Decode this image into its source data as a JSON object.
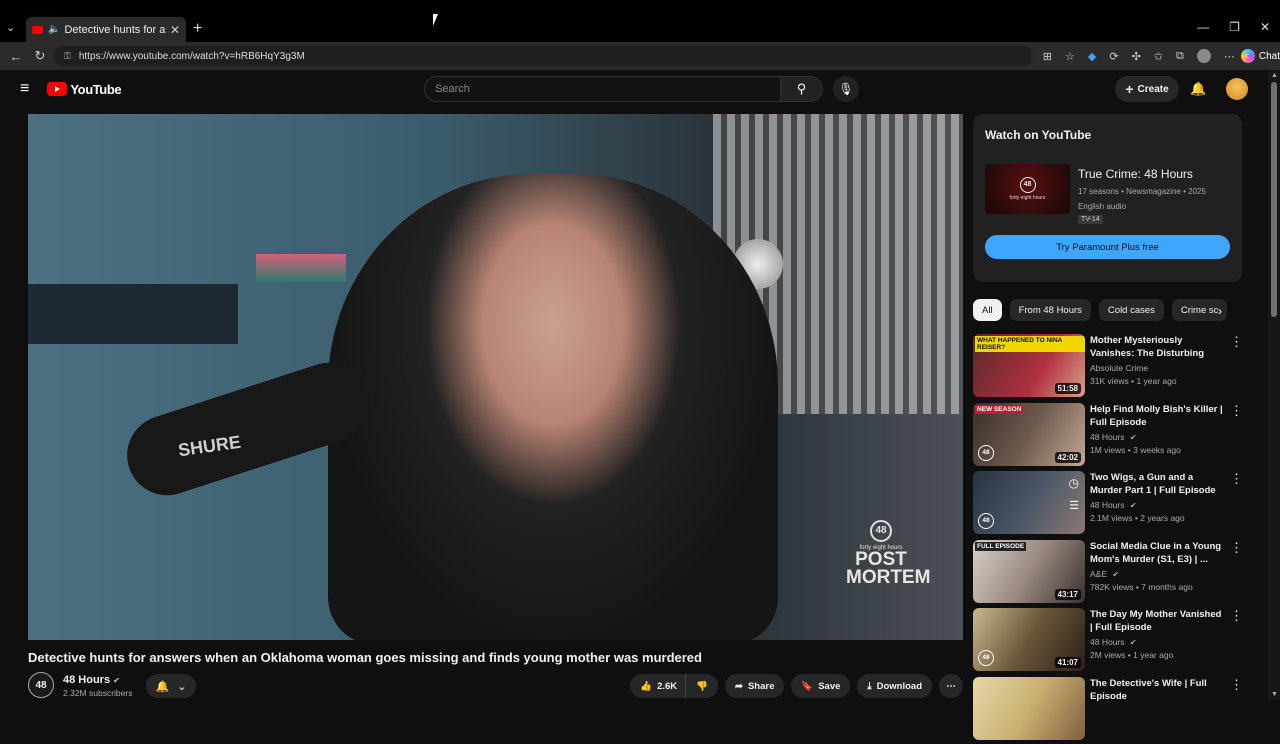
{
  "browser": {
    "tab_title": "Detective hunts for answers w",
    "tab_close": "✕",
    "new_tab": "+",
    "url": "https://www.youtube.com/watch?v=hRB6HqY3g3M",
    "chat_label": "Chat",
    "window_min": "—",
    "window_restore": "❐",
    "window_close": "✕"
  },
  "header": {
    "logo_text": "YouTube",
    "search_placeholder": "Search",
    "create_label": "Create"
  },
  "video": {
    "mic_brand": "SHURE",
    "badge_number": "48",
    "badge_small": "forty eight hours",
    "badge_line1": "POST",
    "badge_line2": "MORTEM",
    "title": "Detective hunts for answers when an Oklahoma woman goes missing and finds young mother was murdered"
  },
  "channel": {
    "avatar_text": "48",
    "name": "48 Hours",
    "subscribers": "2.32M subscribers"
  },
  "actions": {
    "likes": "2.6K",
    "share": "Share",
    "save": "Save",
    "download": "Download"
  },
  "watch_card": {
    "heading": "Watch on YouTube",
    "thumb_number": "48",
    "thumb_small": "forty eight hours",
    "title": "True Crime: 48 Hours",
    "meta": "17 seasons • Newsmagazine • 2025",
    "audio": "English audio",
    "rating": "TV-14",
    "button": "Try Paramount Plus free"
  },
  "chips": [
    "All",
    "From 48 Hours",
    "Cold cases",
    "Crime sc"
  ],
  "recommendations": [
    {
      "title": "Mother Mysteriously Vanishes: The Disturbing Story of Nina ...",
      "channel": "Absolute Crime",
      "meta": "31K views • 1 year ago",
      "duration": "51:58",
      "badge": "WHAT HAPPENED TO NINA REISER?",
      "badge_color": "#f2d600",
      "thumb_bg": "#b03040",
      "logo": "",
      "verified": false
    },
    {
      "title": "Help Find Molly Bish's Killer | Full Episode",
      "channel": "48 Hours",
      "meta": "1M views • 3 weeks ago",
      "duration": "42:02",
      "badge": "NEW SEASON",
      "badge_color": "#c0202a",
      "thumb_bg": "#6d5a4e",
      "logo": "48",
      "verified": true
    },
    {
      "title": "Two Wigs, a Gun and a Murder Part 1 | Full Episode",
      "channel": "48 Hours",
      "meta": "2.1M views • 2 years ago",
      "duration": "",
      "badge": "",
      "badge_color": "",
      "thumb_bg": "#4a5566",
      "logo": "48",
      "verified": true
    },
    {
      "title": "Social Media Clue in a Young Mom's Murder (S1, E3) | ...",
      "channel": "A&E",
      "meta": "782K views • 7 months ago",
      "duration": "43:17",
      "badge": "FULL EPISODE",
      "badge_color": "#222222",
      "thumb_bg": "#9a8a80",
      "logo": "",
      "verified": true
    },
    {
      "title": "The Day My Mother Vanished | Full Episode",
      "channel": "48 Hours",
      "meta": "2M views • 1 year ago",
      "duration": "41:07",
      "badge": "",
      "badge_color": "",
      "thumb_bg": "#6b5638",
      "logo": "48",
      "verified": true
    },
    {
      "title": "The Detective's Wife | Full Episode",
      "channel": "",
      "meta": "",
      "duration": "",
      "badge": "",
      "badge_color": "",
      "thumb_bg": "#c8b070",
      "logo": "",
      "verified": false
    }
  ]
}
